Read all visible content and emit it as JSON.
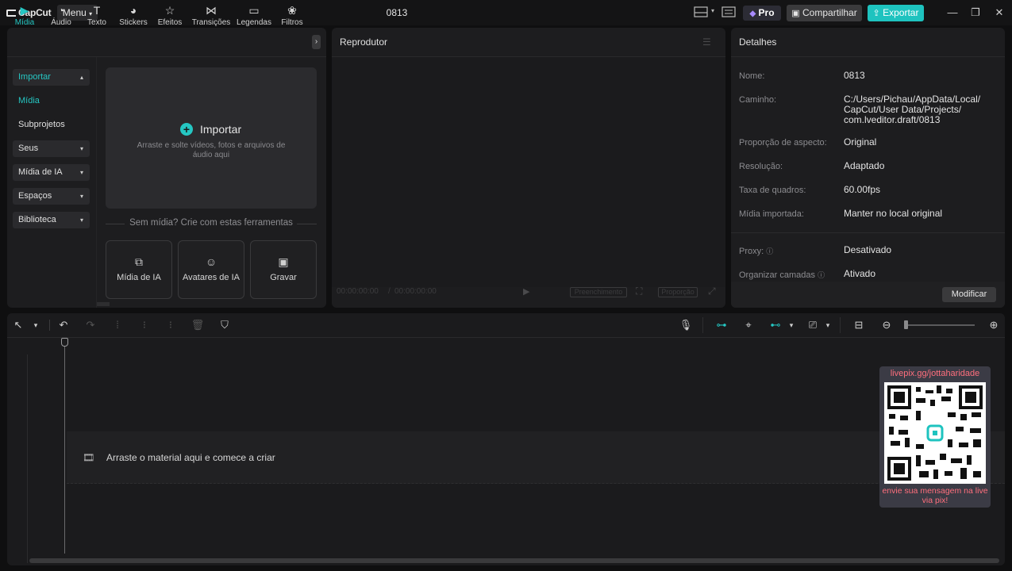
{
  "app": {
    "logo_text": "CapCut",
    "menu_label": "Menu",
    "project_name": "0813"
  },
  "topbar": {
    "pro_label": "Pro",
    "share_label": "Compartilhar",
    "export_label": "Exportar"
  },
  "media": {
    "tabs": [
      {
        "label": "Mídia",
        "icon": "media-icon"
      },
      {
        "label": "Áudio",
        "icon": "audio-icon"
      },
      {
        "label": "Texto",
        "icon": "text-icon"
      },
      {
        "label": "Stickers",
        "icon": "sticker-icon"
      },
      {
        "label": "Efeitos",
        "icon": "effects-icon"
      },
      {
        "label": "Transições",
        "icon": "transitions-icon"
      },
      {
        "label": "Legendas",
        "icon": "captions-icon"
      },
      {
        "label": "Filtros",
        "icon": "filters-icon"
      }
    ],
    "sidebar": [
      {
        "label": "Importar"
      },
      {
        "label": "Mídia"
      },
      {
        "label": "Subprojetos"
      },
      {
        "label": "Seus"
      },
      {
        "label": "Mídia de IA"
      },
      {
        "label": "Espaços"
      },
      {
        "label": "Biblioteca"
      }
    ],
    "import_title": "Importar",
    "import_hint": "Arraste e solte vídeos, fotos e arquivos de áudio aqui",
    "no_media_text": "Sem mídia? Crie com estas ferramentas",
    "tools": [
      {
        "label": "Mídia de IA"
      },
      {
        "label": "Avatares de IA"
      },
      {
        "label": "Gravar"
      }
    ]
  },
  "player": {
    "title": "Reprodutor",
    "time_current": "00:00:00:00",
    "time_separator": "/",
    "time_duration": "00:00:00:00",
    "fill_label": "Preenchimento",
    "ratio_label": "Proporção"
  },
  "details": {
    "title": "Detalhes",
    "rows": [
      {
        "label": "Nome:",
        "value": "0813"
      },
      {
        "label": "Caminho:",
        "value_lines": [
          "C:/Users/Pichau/AppData/Local/",
          "CapCut/User Data/Projects/",
          "com.lveditor.draft/0813"
        ]
      },
      {
        "label": "Proporção de aspecto:",
        "value": "Original"
      },
      {
        "label": "Resolução:",
        "value": "Adaptado"
      },
      {
        "label": "Taxa de quadros:",
        "value": "60.00fps"
      },
      {
        "label": "Mídia importada:",
        "value": "Manter no local original"
      },
      {
        "label": "Proxy:",
        "value": "Desativado"
      },
      {
        "label": "Organizar camadas",
        "value": "Ativado"
      }
    ],
    "modify_label": "Modificar"
  },
  "timeline": {
    "drop_text": "Arraste o material aqui e comece a criar",
    "zoom_level": 0.02
  },
  "overlay": {
    "url": "livepix.gg/jottaharidade",
    "message": "envie sua mensagem na live via pix!"
  },
  "colors": {
    "accent": "#1ec3bf",
    "overlay_text": "#ff6f7d"
  }
}
